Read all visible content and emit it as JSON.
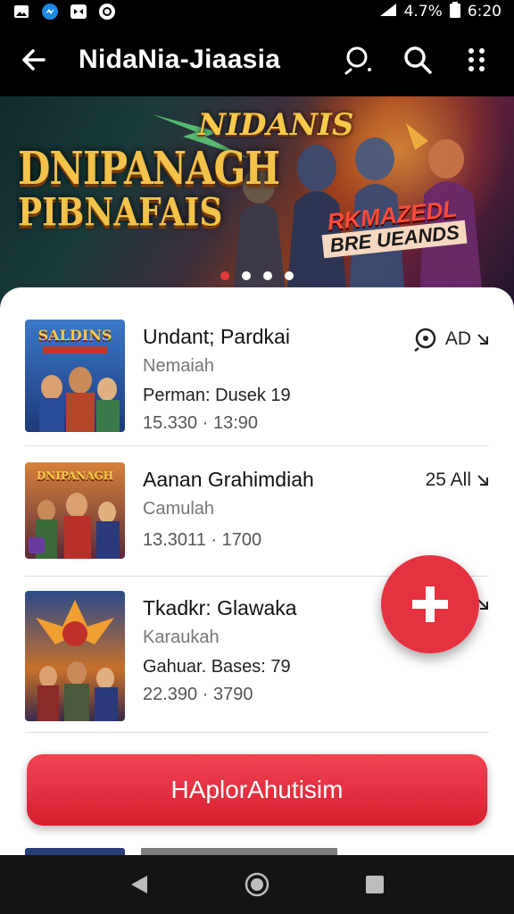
{
  "status_bar": {
    "left_icons": [
      "gallery-icon",
      "messenger-icon",
      "game-controller-icon",
      "clock-icon"
    ],
    "battery_text": "4.7%",
    "time": "6:20"
  },
  "app_bar": {
    "title": "NidaNia-Jiaasia",
    "icons": [
      "back-arrow-icon",
      "search-person-icon",
      "search-icon",
      "more-vert-icon"
    ]
  },
  "banner": {
    "logo_left_line1": "DNIPANAGH",
    "logo_left_line2": "PIBNAFAIS",
    "logo_top": "NIDANIS",
    "subtitle_line1": "RKMAZEDL",
    "subtitle_line2": "BRE UEANDS",
    "pager": {
      "count": 4,
      "active_index": 0
    }
  },
  "items": [
    {
      "thumb_label": "SALDINS",
      "title": "Undant; Pardkai",
      "subtitle": "Nemaiah",
      "detail": "Perman: Dusek 19",
      "meta": "15.330 · 13:90",
      "right_text": "AD",
      "right_icon": "search-person-icon"
    },
    {
      "thumb_label": "DNIPANAGH",
      "title": "Aanan Grahimdiah",
      "subtitle": "Camulah",
      "detail": "",
      "meta": "13.3011 · 1700",
      "right_text": "25 All",
      "right_icon": "arrow-icon"
    },
    {
      "thumb_label": "",
      "title": "Tkadkr: Glawaka",
      "subtitle": "Karaukah",
      "detail": "Gahuar. Bases: 79",
      "meta": "22.390 · 3790",
      "right_text": "",
      "right_icon": "arrow-icon"
    }
  ],
  "fab": {
    "icon": "plus-icon"
  },
  "cta_button": {
    "label": "HAplorAhutisim"
  },
  "nav_bar": {
    "icons": [
      "nav-back-icon",
      "nav-home-icon",
      "nav-recents-icon"
    ]
  },
  "colors": {
    "accent_red": "#e53240",
    "app_bar_bg": "#000000",
    "card_bg": "#ffffff"
  }
}
